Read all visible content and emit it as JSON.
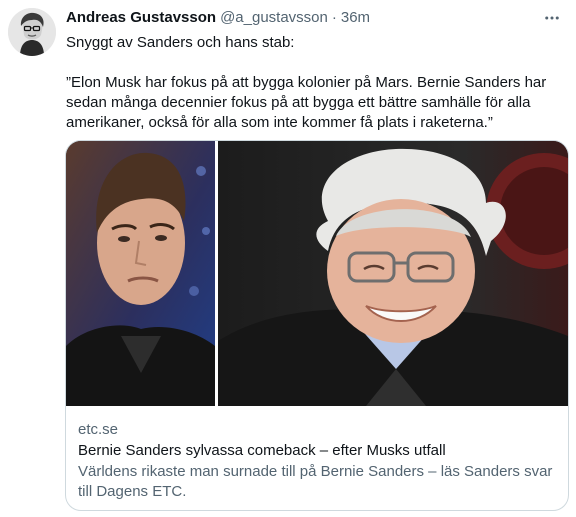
{
  "author": {
    "display_name": "Andreas Gustavsson",
    "handle": "@a_gustavsson",
    "separator": "·",
    "time": "36m"
  },
  "tweet": {
    "paragraph_1": "Snyggt av Sanders och hans stab:",
    "paragraph_2": "”Elon Musk har fokus på att bygga kolonier på Mars. Bernie Sanders har sedan många decennier fokus på att bygga ett bättre samhälle för alla amerikaner, också för alla som inte kommer få plats i raketerna.”"
  },
  "link_card": {
    "domain": "etc.se",
    "title": "Bernie Sanders sylvassa comeback – efter Musks utfall",
    "description": "Världens rikaste man surnade till på Bernie Sanders – läs Sanders svar till Dagens ETC."
  },
  "icons": {
    "more": "more-horizontal-icon"
  },
  "colors": {
    "text": "#0f1419",
    "secondary": "#536471",
    "border": "#cfd9de"
  }
}
